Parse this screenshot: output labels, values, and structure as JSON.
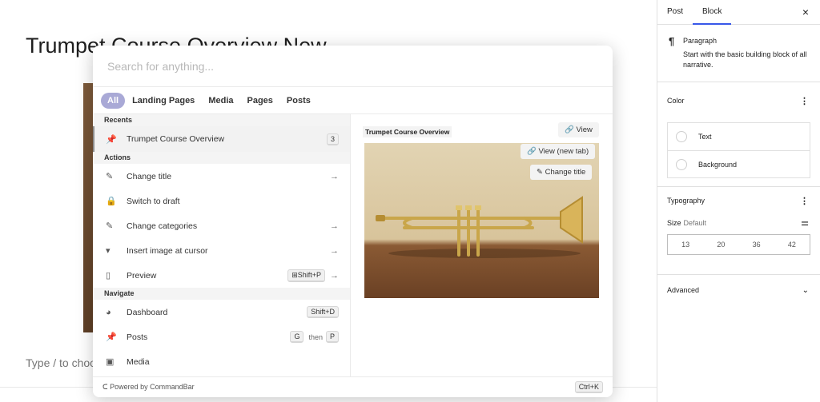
{
  "editor": {
    "post_title": "Trumpet Course Overview New",
    "placeholder": "Type / to choose a block"
  },
  "sidebar": {
    "tabs": [
      {
        "label": "Post"
      },
      {
        "label": "Block"
      }
    ],
    "close_icon": "×",
    "block": {
      "icon": "¶",
      "title": "Paragraph",
      "description": "Start with the basic building block of all narrative."
    },
    "color": {
      "title": "Color",
      "items": [
        {
          "label": "Text"
        },
        {
          "label": "Background"
        }
      ]
    },
    "typography": {
      "title": "Typography",
      "size_label": "Size",
      "size_default": "Default",
      "sizes": [
        "13",
        "20",
        "36",
        "42"
      ]
    },
    "advanced": {
      "title": "Advanced"
    }
  },
  "palette": {
    "search_placeholder": "Search for anything...",
    "tabs": [
      "All",
      "Landing Pages",
      "Media",
      "Pages",
      "Posts"
    ],
    "sections": {
      "recents": "Recents",
      "actions": "Actions",
      "navigate": "Navigate"
    },
    "recents": [
      {
        "label": "Trumpet Course Overview",
        "badge": "3"
      }
    ],
    "actions": [
      {
        "label": "Change title"
      },
      {
        "label": "Switch to draft"
      },
      {
        "label": "Change categories"
      },
      {
        "label": "Insert image at cursor"
      },
      {
        "label": "Preview",
        "shortcut": "⊞Shift+P"
      }
    ],
    "navigate": [
      {
        "label": "Dashboard",
        "shortcut": "Shift+D"
      },
      {
        "label": "Posts",
        "key1": "G",
        "then": "then",
        "key2": "P"
      },
      {
        "label": "Media"
      }
    ],
    "preview": {
      "title": "Trumpet Course Overview",
      "buttons": {
        "view": "View",
        "view_new_tab": "View (new tab)",
        "change_title": "Change title"
      }
    },
    "footer": {
      "powered_by": "Powered by CommandBar",
      "shortcut": "Ctrl+K"
    }
  },
  "colors": {
    "accent": "#3858e9",
    "tab_active": "#a9a9d6"
  }
}
